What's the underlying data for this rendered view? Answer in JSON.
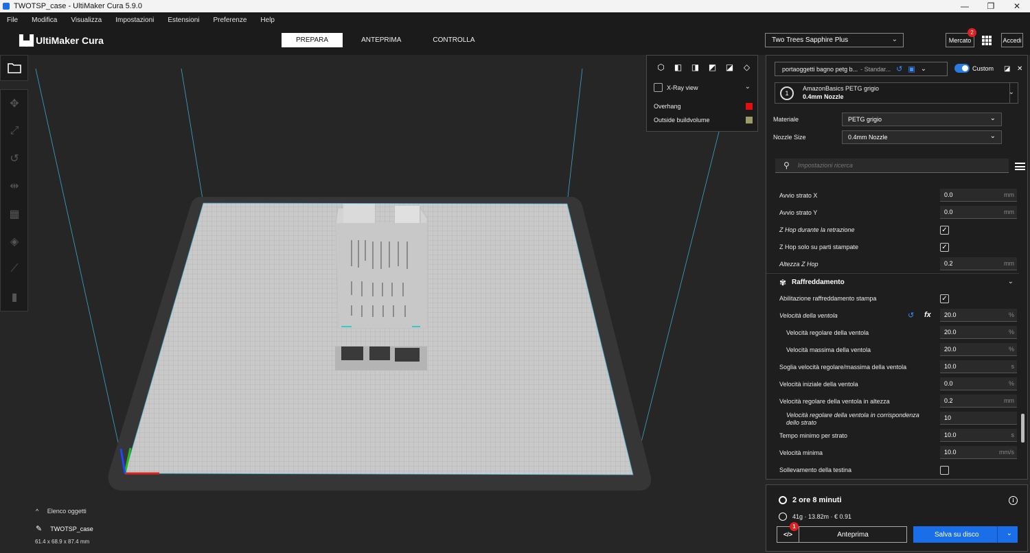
{
  "window": {
    "title": "TWOTSP_case - UltiMaker Cura 5.9.0",
    "minimize": "—",
    "maximize": "❐",
    "close": "✕"
  },
  "menu": [
    "File",
    "Modifica",
    "Visualizza",
    "Impostazioni",
    "Estensioni",
    "Preferenze",
    "Help"
  ],
  "header": {
    "logo": "UltiMaker Cura",
    "tabs": [
      "PREPARA",
      "ANTEPRIMA",
      "CONTROLLA"
    ],
    "active_tab": "PREPARA",
    "printer": "Two Trees Sapphire Plus",
    "marketplace_label": "Mercato",
    "marketplace_badge": "2",
    "login_label": "Accedi"
  },
  "view_panel": {
    "xray_label": "X-Ray view",
    "legend": [
      {
        "label": "Overhang",
        "color": "#e01010"
      },
      {
        "label": "Outside buildvolume",
        "color": "#9a9a6a"
      }
    ]
  },
  "objects": {
    "list_label": "Elenco oggetti",
    "object_name": "TWOTSP_case",
    "dimensions": "61.4 x 68.9 x 87.4 mm"
  },
  "settings": {
    "profile_name": "portaoggetti bagno petg b...",
    "profile_quality": "- Standar...",
    "custom_label": "Custom",
    "extruder": {
      "number": "1",
      "material": "AmazonBasics PETG grigio",
      "nozzle": "0.4mm Nozzle"
    },
    "material_label": "Materiale",
    "material_value": "PETG grigio",
    "nozzle_label": "Nozzle Size",
    "nozzle_value": "0.4mm Nozzle",
    "search_placeholder": "Impostazioni ricerca",
    "rows": {
      "avvio_x": {
        "label": "Avvio strato X",
        "value": "0.0",
        "unit": "mm"
      },
      "avvio_y": {
        "label": "Avvio strato Y",
        "value": "0.0",
        "unit": "mm"
      },
      "zhop_retr": {
        "label": "Z Hop durante la retrazione"
      },
      "zhop_parts": {
        "label": "Z Hop solo su parti stampate"
      },
      "zhop_height": {
        "label": "Altezza Z Hop",
        "value": "0.2",
        "unit": "mm"
      },
      "cooling_section": "Raffreddamento",
      "cooling_enable": {
        "label": "Abilitazione raffreddamento stampa"
      },
      "fan_speed": {
        "label": "Velocità della ventola",
        "value": "20.0",
        "unit": "%"
      },
      "fan_regular": {
        "label": "Velocità regolare della ventola",
        "value": "20.0",
        "unit": "%"
      },
      "fan_max": {
        "label": "Velocità massima della ventola",
        "value": "20.0",
        "unit": "%"
      },
      "fan_threshold": {
        "label": "Soglia velocità regolare/massima della ventola",
        "value": "10.0",
        "unit": "s"
      },
      "fan_initial": {
        "label": "Velocità iniziale della ventola",
        "value": "0.0",
        "unit": "%"
      },
      "fan_height": {
        "label": "Velocità regolare della ventola in altezza",
        "value": "0.2",
        "unit": "mm"
      },
      "fan_layer": {
        "label": "Velocità regolare della ventola in corrispondenza dello strato",
        "value": "10"
      },
      "min_layer_time": {
        "label": "Tempo minimo per strato",
        "value": "10.0",
        "unit": "s"
      },
      "min_speed": {
        "label": "Velocità minima",
        "value": "10.0",
        "unit": "mm/s"
      },
      "head_lift": {
        "label": "Sollevamento della testina"
      }
    }
  },
  "action": {
    "print_time": "2 ore 8 minuti",
    "material_info": "41g · 13.82m · € 0.91",
    "gcode_badge": "1",
    "preview_label": "Anteprima",
    "save_label": "Salva su disco"
  },
  "colors": {
    "accent": "#1a6fe8",
    "badge": "#e02020",
    "build_plate": "#c8c8c8",
    "axis_x": "#d22",
    "axis_y": "#2b2",
    "axis_z": "#24f"
  }
}
